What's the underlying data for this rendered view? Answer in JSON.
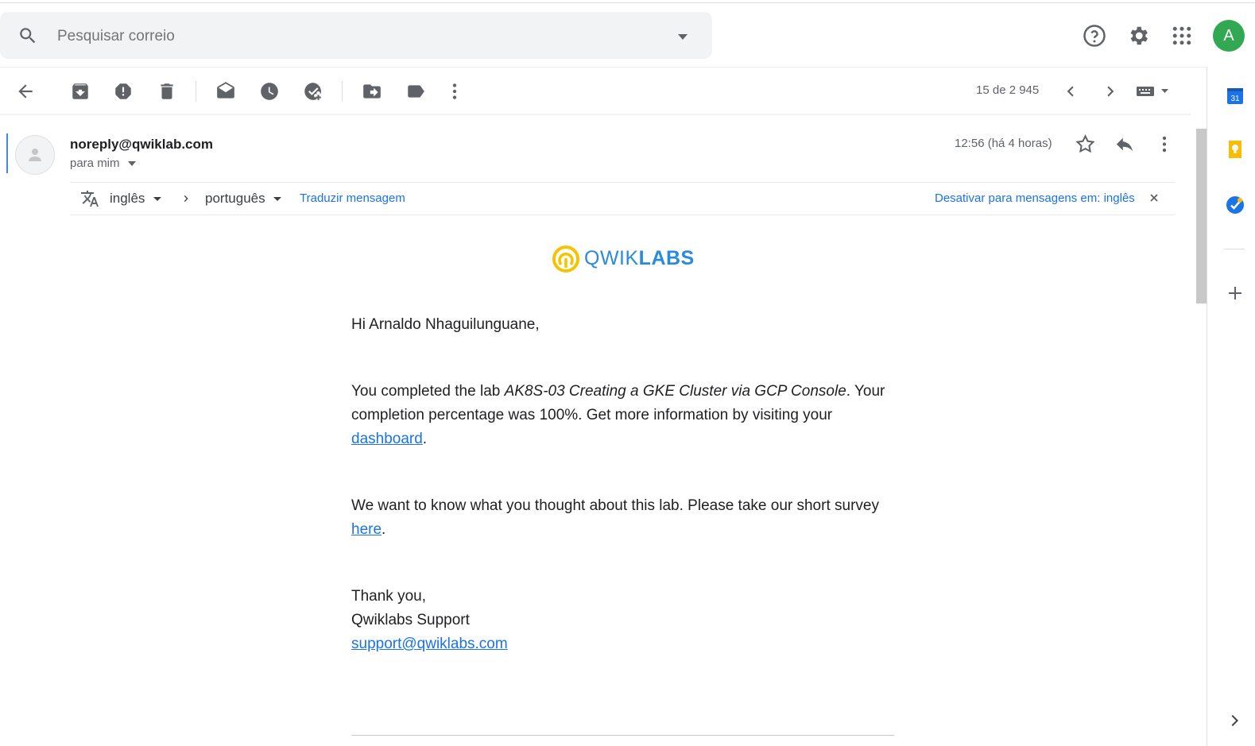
{
  "search": {
    "placeholder": "Pesquisar correio"
  },
  "header": {
    "avatar_letter": "A"
  },
  "toolbar": {
    "icons": [
      "back-icon",
      "archive-icon",
      "report-spam-icon",
      "delete-icon",
      "mark-unread-icon",
      "snooze-icon",
      "add-task-icon",
      "move-to-icon",
      "label-icon",
      "more-icon"
    ],
    "pager": "15 de 2 945"
  },
  "message": {
    "sender": "noreply@qwiklab.com",
    "to": "para mim",
    "timestamp": "12:56 (há 4 horas)"
  },
  "translate": {
    "source_lang": "inglês",
    "target_lang": "português",
    "translate_link": "Traduzir mensagem",
    "disable_link": "Desativar para mensagens em: inglês"
  },
  "email_body": {
    "logo_text_light": "QWIK",
    "logo_text_bold": "LABS",
    "greeting": "Hi Arnaldo Nhaguilunguane,",
    "p1_prefix": "You completed the lab ",
    "p1_lab": "AK8S-03 Creating a GKE Cluster via GCP Console",
    "p1_middle": ". Your completion percentage was 100%. Get more information by visiting your ",
    "p1_link": "dashboard",
    "p1_suffix": ".",
    "p2_prefix": "We want to know what you thought about this lab. Please take our short survey ",
    "p2_link": "here",
    "p2_suffix": ".",
    "thanks": "Thank you,",
    "signature": "Qwiklabs Support",
    "support_email": "support@qwiklabs.com"
  },
  "side_panel": {
    "calendar_day": "31",
    "icons": [
      "calendar-icon",
      "keep-icon",
      "tasks-icon",
      "add-addon-icon",
      "expand-panel-icon"
    ]
  },
  "colors": {
    "accent": "#1a73e8",
    "avatar_bg": "#33a852",
    "logo_yellow": "#f5c400",
    "logo_blue": "#2a8bdc"
  }
}
